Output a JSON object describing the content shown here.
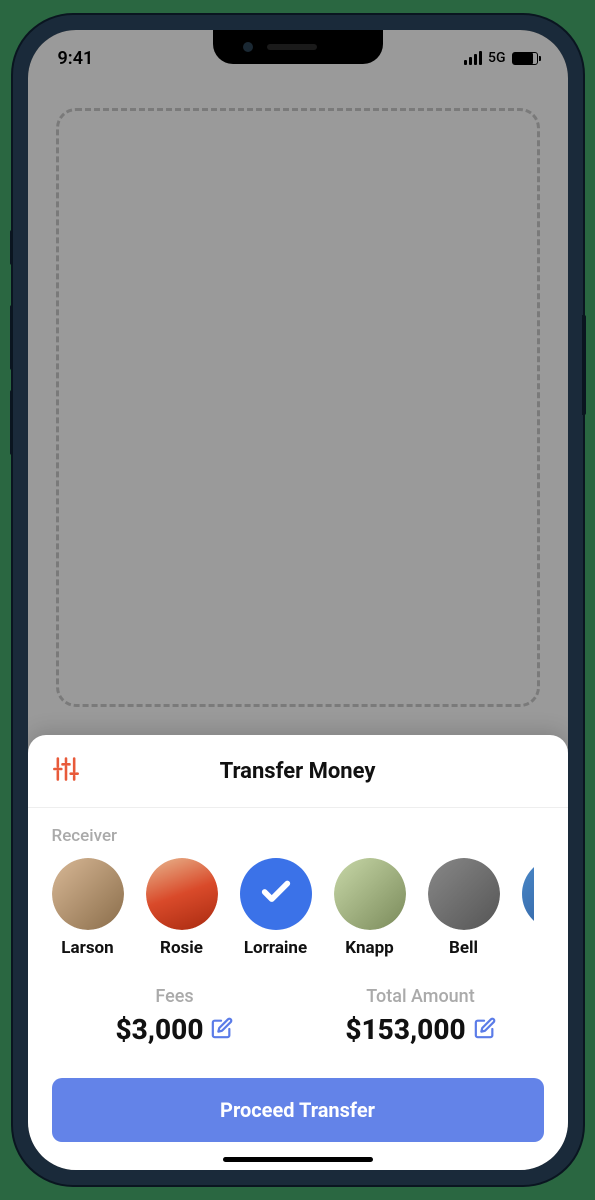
{
  "status_bar": {
    "time": "9:41",
    "network": "5G"
  },
  "sheet": {
    "title": "Transfer Money",
    "receiver_label": "Receiver",
    "receivers": [
      {
        "name": "Larson",
        "selected": false
      },
      {
        "name": "Rosie",
        "selected": false
      },
      {
        "name": "Lorraine",
        "selected": true
      },
      {
        "name": "Knapp",
        "selected": false
      },
      {
        "name": "Bell",
        "selected": false
      }
    ],
    "fees": {
      "label": "Fees",
      "value": "$3,000"
    },
    "total": {
      "label": "Total Amount",
      "value": "$153,000"
    },
    "cta": "Proceed Transfer"
  }
}
